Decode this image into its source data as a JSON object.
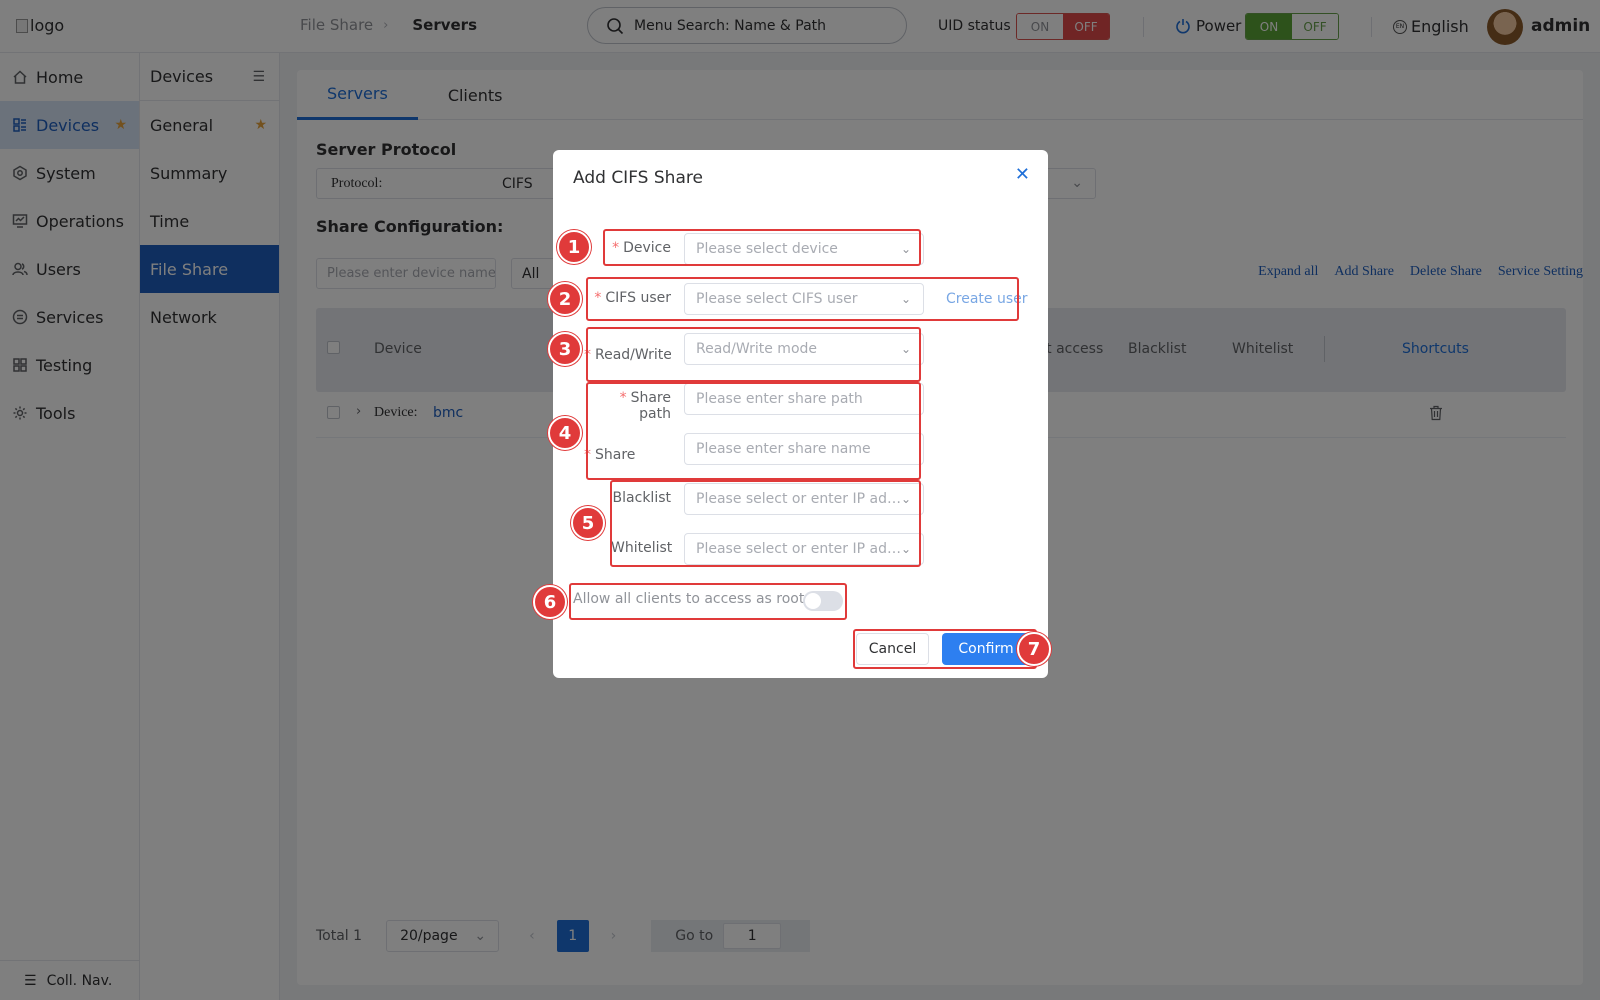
{
  "header": {
    "logo_alt": "logo",
    "breadcrumb": [
      "File Share",
      "Servers"
    ],
    "search_placeholder": "Menu Search: Name & Path",
    "uid_label": "UID status",
    "uid_on": "ON",
    "uid_off": "OFF",
    "power_label": "Power",
    "power_on": "ON",
    "power_off": "OFF",
    "language": "English",
    "user": "admin"
  },
  "nav_primary": {
    "items": [
      {
        "label": "Home",
        "icon": "home-icon"
      },
      {
        "label": "Devices",
        "icon": "devices-icon",
        "active": true
      },
      {
        "label": "System",
        "icon": "system-icon"
      },
      {
        "label": "Operations",
        "icon": "operations-icon"
      },
      {
        "label": "Users",
        "icon": "users-icon"
      },
      {
        "label": "Services",
        "icon": "services-icon"
      },
      {
        "label": "Testing",
        "icon": "testing-icon"
      },
      {
        "label": "Tools",
        "icon": "tools-icon"
      }
    ],
    "collapse_label": "Coll. Nav."
  },
  "nav_secondary": {
    "title": "Devices",
    "items": [
      "General",
      "Summary",
      "Time",
      "File Share",
      "Network"
    ]
  },
  "main": {
    "tabs": [
      "Servers",
      "Clients"
    ],
    "server_protocol_title": "Server Protocol",
    "protocol_label": "Protocol:",
    "protocol_value": "CIFS",
    "share_config_title": "Share Configuration:",
    "device_filter_placeholder": "Please enter device name",
    "filter_all": "All",
    "links": [
      "Expand all",
      "Add Share",
      "Delete Share",
      "Service Setting"
    ],
    "columns": {
      "device": "Device",
      "root_access": "oot access",
      "blacklist": "Blacklist",
      "whitelist": "Whitelist",
      "shortcuts": "Shortcuts"
    },
    "row": {
      "device_label": "Device:",
      "device_value": "bmc"
    },
    "pager": {
      "total": "Total 1",
      "page_size": "20/page",
      "page": "1",
      "goto_label": "Go to",
      "goto_value": "1"
    }
  },
  "dialog": {
    "title": "Add CIFS Share",
    "fields": {
      "device_label": "Device",
      "device_placeholder": "Please select device",
      "cifs_user_label": "CIFS user",
      "cifs_user_placeholder": "Please select CIFS user",
      "create_user": "Create user",
      "rw_label": "Read/Write mode",
      "rw_placeholder": "Read/Write mode",
      "share_path_label": "Share path",
      "share_path_placeholder": "Please enter share path",
      "share_name_label": "Share name",
      "share_name_placeholder": "Please enter share name",
      "blacklist_label": "Blacklist",
      "blacklist_placeholder": "Please select or enter IP ad…",
      "whitelist_label": "Whitelist",
      "whitelist_placeholder": "Please select or enter IP ad…",
      "root_access_label": "Allow all clients to access as root"
    },
    "cancel": "Cancel",
    "confirm": "Confirm"
  },
  "annotations": [
    "1",
    "2",
    "3",
    "4",
    "5",
    "6",
    "7"
  ],
  "colors": {
    "accent": "#1f6fd8",
    "annotation": "#e03a3a",
    "uid_off": "#e04b4b",
    "power_on": "#5aa536"
  }
}
